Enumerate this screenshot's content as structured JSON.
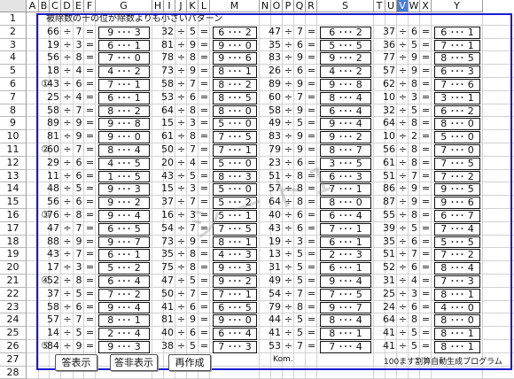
{
  "columns": [
    "A",
    "B",
    "C",
    "D",
    "E",
    "F",
    "G",
    "H",
    "I",
    "J",
    "K",
    "L",
    "M",
    "N",
    "O",
    "P",
    "Q",
    "R",
    "S",
    "T",
    "U",
    "V",
    "W",
    "X",
    "Y"
  ],
  "selected_column": "V",
  "rows": [
    "1",
    "2",
    "3",
    "4",
    "5",
    "6",
    "7",
    "8",
    "9",
    "10",
    "11",
    "12",
    "13",
    "14",
    "15",
    "16",
    "17",
    "18",
    "19",
    "20",
    "21",
    "22",
    "23",
    "24",
    "25",
    "26",
    "27",
    "28"
  ],
  "title": "被除数の十の位が除数よりも小さいパターン",
  "div_sign": "÷",
  "eq_sign": "=",
  "rem_sign": "･･･",
  "section_markers": [
    {
      "row": 6,
      "label": "①"
    },
    {
      "row": 11,
      "label": "②"
    },
    {
      "row": 16,
      "label": "③"
    },
    {
      "row": 21,
      "label": "④"
    },
    {
      "row": 26,
      "label": "⑤"
    }
  ],
  "problems": [
    [
      [
        66,
        7,
        9,
        3
      ],
      [
        32,
        5,
        6,
        2
      ],
      [
        47,
        7,
        6,
        2
      ],
      [
        37,
        6,
        6,
        1
      ]
    ],
    [
      [
        19,
        3,
        6,
        1
      ],
      [
        81,
        9,
        9,
        0
      ],
      [
        35,
        6,
        5,
        5
      ],
      [
        36,
        5,
        7,
        1
      ]
    ],
    [
      [
        56,
        8,
        7,
        0
      ],
      [
        78,
        8,
        9,
        6
      ],
      [
        83,
        9,
        9,
        2
      ],
      [
        77,
        9,
        8,
        5
      ]
    ],
    [
      [
        18,
        4,
        4,
        2
      ],
      [
        73,
        9,
        8,
        1
      ],
      [
        26,
        6,
        4,
        2
      ],
      [
        57,
        9,
        6,
        3
      ]
    ],
    [
      [
        43,
        6,
        7,
        1
      ],
      [
        58,
        7,
        8,
        2
      ],
      [
        89,
        9,
        9,
        8
      ],
      [
        62,
        8,
        7,
        6
      ]
    ],
    [
      [
        25,
        4,
        6,
        1
      ],
      [
        53,
        6,
        8,
        5
      ],
      [
        60,
        7,
        8,
        4
      ],
      [
        10,
        3,
        3,
        1
      ]
    ],
    [
      [
        58,
        7,
        8,
        2
      ],
      [
        64,
        8,
        8,
        0
      ],
      [
        58,
        9,
        6,
        4
      ],
      [
        32,
        5,
        6,
        2
      ]
    ],
    [
      [
        89,
        9,
        9,
        8
      ],
      [
        15,
        3,
        5,
        0
      ],
      [
        49,
        5,
        9,
        4
      ],
      [
        64,
        8,
        8,
        0
      ]
    ],
    [
      [
        81,
        9,
        9,
        0
      ],
      [
        61,
        8,
        7,
        5
      ],
      [
        83,
        9,
        9,
        2
      ],
      [
        10,
        2,
        5,
        0
      ]
    ],
    [
      [
        60,
        7,
        8,
        4
      ],
      [
        50,
        7,
        7,
        1
      ],
      [
        79,
        9,
        8,
        7
      ],
      [
        56,
        8,
        7,
        0
      ]
    ],
    [
      [
        29,
        6,
        4,
        5
      ],
      [
        20,
        4,
        5,
        0
      ],
      [
        23,
        6,
        3,
        5
      ],
      [
        61,
        8,
        7,
        5
      ]
    ],
    [
      [
        11,
        6,
        1,
        5
      ],
      [
        43,
        5,
        8,
        3
      ],
      [
        51,
        8,
        6,
        3
      ],
      [
        51,
        7,
        7,
        2
      ]
    ],
    [
      [
        48,
        5,
        9,
        3
      ],
      [
        15,
        3,
        5,
        0
      ],
      [
        57,
        8,
        7,
        1
      ],
      [
        86,
        9,
        9,
        5
      ]
    ],
    [
      [
        56,
        6,
        9,
        2
      ],
      [
        37,
        7,
        5,
        2
      ],
      [
        64,
        8,
        8,
        0
      ],
      [
        87,
        9,
        9,
        6
      ]
    ],
    [
      [
        76,
        8,
        9,
        4
      ],
      [
        16,
        3,
        5,
        1
      ],
      [
        40,
        6,
        6,
        4
      ],
      [
        55,
        8,
        6,
        7
      ]
    ],
    [
      [
        47,
        7,
        6,
        5
      ],
      [
        54,
        7,
        7,
        5
      ],
      [
        43,
        6,
        7,
        1
      ],
      [
        39,
        5,
        7,
        4
      ]
    ],
    [
      [
        88,
        9,
        9,
        7
      ],
      [
        73,
        9,
        8,
        1
      ],
      [
        19,
        3,
        6,
        1
      ],
      [
        35,
        6,
        5,
        5
      ]
    ],
    [
      [
        43,
        7,
        6,
        1
      ],
      [
        35,
        8,
        4,
        3
      ],
      [
        13,
        5,
        2,
        3
      ],
      [
        51,
        7,
        7,
        2
      ]
    ],
    [
      [
        17,
        3,
        5,
        2
      ],
      [
        75,
        8,
        9,
        3
      ],
      [
        31,
        5,
        6,
        1
      ],
      [
        52,
        6,
        8,
        4
      ]
    ],
    [
      [
        52,
        8,
        6,
        4
      ],
      [
        47,
        5,
        9,
        2
      ],
      [
        49,
        5,
        9,
        4
      ],
      [
        31,
        4,
        7,
        3
      ]
    ],
    [
      [
        37,
        5,
        7,
        2
      ],
      [
        50,
        7,
        7,
        1
      ],
      [
        54,
        7,
        7,
        5
      ],
      [
        25,
        3,
        8,
        1
      ]
    ],
    [
      [
        58,
        6,
        9,
        4
      ],
      [
        41,
        6,
        6,
        5
      ],
      [
        79,
        8,
        9,
        7
      ],
      [
        24,
        6,
        4,
        0
      ]
    ],
    [
      [
        57,
        7,
        8,
        1
      ],
      [
        81,
        9,
        9,
        0
      ],
      [
        44,
        5,
        8,
        4
      ],
      [
        64,
        8,
        8,
        0
      ]
    ],
    [
      [
        14,
        5,
        2,
        4
      ],
      [
        40,
        6,
        6,
        4
      ],
      [
        41,
        5,
        8,
        1
      ],
      [
        41,
        5,
        8,
        1
      ]
    ],
    [
      [
        84,
        9,
        9,
        3
      ],
      [
        38,
        5,
        7,
        3
      ],
      [
        53,
        7,
        7,
        4
      ],
      [
        41,
        5,
        8,
        1
      ]
    ]
  ],
  "buttons": {
    "show_answers": "答表示",
    "hide_answers": "答非表示",
    "regenerate": "再作成"
  },
  "footer_left": "Kom.",
  "footer_right": "100ます割算自動生成プログラム",
  "watermark": "シート1"
}
